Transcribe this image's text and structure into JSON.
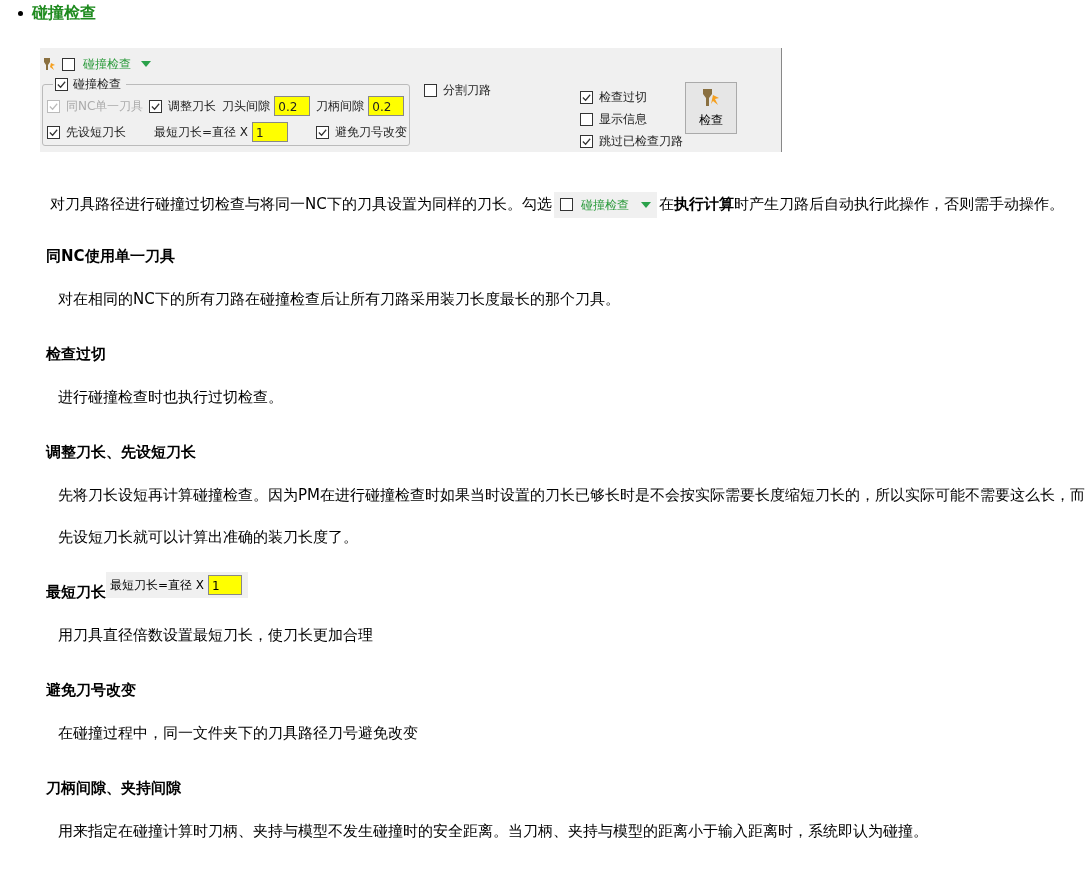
{
  "heading": "碰撞检查",
  "panel": {
    "toolbar": {
      "checked": false,
      "label": "碰撞检查"
    },
    "group": {
      "title": "碰撞检查",
      "checked": true,
      "line1": [
        {
          "kind": "checkbox",
          "label": "同NC单一刀具",
          "checked": true,
          "disabled": true
        },
        {
          "kind": "checkbox",
          "label": "调整刀长",
          "checked": true,
          "disabled": false
        },
        {
          "kind": "field",
          "label": "刀头间隙",
          "value": "0.2"
        },
        {
          "kind": "field",
          "label": "刀柄间隙",
          "value": "0.2"
        }
      ],
      "line2": [
        {
          "kind": "checkbox",
          "label": "先设短刀长",
          "checked": true,
          "disabled": false
        },
        {
          "kind": "field",
          "label": "最短刀长=直径 X",
          "value": "1"
        },
        {
          "kind": "checkbox",
          "label": "避免刀号改变",
          "checked": true,
          "disabled": false
        }
      ]
    },
    "split": {
      "label": "分割刀路",
      "checked": false
    },
    "checks": [
      {
        "label": "检查过切",
        "checked": true
      },
      {
        "label": "显示信息",
        "checked": false
      },
      {
        "label": "跳过已检查刀路",
        "checked": true
      }
    ],
    "button": "检查"
  },
  "intro": {
    "before": "对刀具路径进行碰撞过切检查与将同一NC下的刀具设置为同样的刀长。勾选",
    "widget": {
      "checked": false,
      "label": "碰撞检查"
    },
    "after": "在**执行计算**时产生刀路后自动执行此操作，否则需手动操作。"
  },
  "sections": [
    {
      "title": "同NC使用单一刀具",
      "body": [
        "对在相同的NC下的所有刀路在碰撞检查后让所有刀路采用装刀长度最长的那个刀具。"
      ]
    },
    {
      "title": "检查过切",
      "body": [
        "进行碰撞检查时也执行过切检查。"
      ]
    },
    {
      "title": "调整刀长、先设短刀长",
      "body": [
        "先将刀长设短再计算碰撞检查。因为PM在进行碰撞检查时如果当时设置的刀长已够长时是不会按实际需要长度缩短刀长的，所以实际可能不需要这么长，而先设短刀长就可以计算出准确的装刀长度了。"
      ]
    },
    {
      "title": "最短刀长",
      "inset": {
        "label": "最短刀长=直径 X",
        "value": "1"
      },
      "body": [
        "用刀具直径倍数设置最短刀长，使刀长更加合理"
      ]
    },
    {
      "title": "避免刀号改变",
      "body": [
        "在碰撞过程中，同一文件夹下的刀具路径刀号避免改变"
      ]
    },
    {
      "title": "刀柄间隙、夹持间隙",
      "body": [
        "用来指定在碰撞计算时刀柄、夹持与模型不发生碰撞时的安全距离。当刀柄、夹持与模型的距离小于输入距离时，系统即认为碰撞。"
      ]
    }
  ]
}
